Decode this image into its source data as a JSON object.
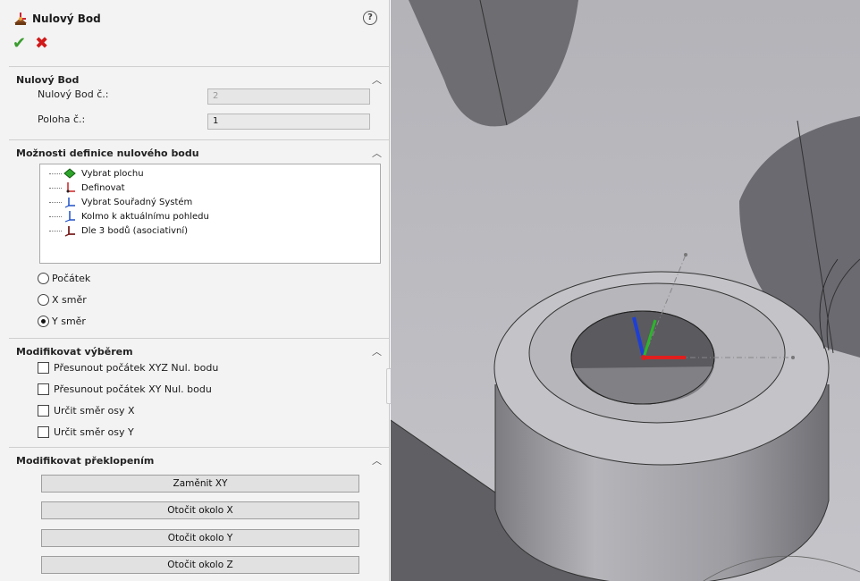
{
  "header": {
    "title": "Nulový Bod",
    "help_icon": "question-circle-icon",
    "ok_icon": "checkmark-icon",
    "cancel_icon": "close-x-icon"
  },
  "section_nulovy_bod": {
    "title": "Nulový Bod",
    "fields": [
      {
        "label": "Nulový Bod č.:",
        "value": "2",
        "disabled": true
      },
      {
        "label": "Poloha č.:",
        "value": "1",
        "disabled": false
      }
    ]
  },
  "section_moznosti": {
    "title": "Možnosti definice nulového bodu",
    "tree_items": [
      {
        "label": "Vybrat plochu",
        "icon": "face-select-icon"
      },
      {
        "label": "Definovat",
        "icon": "define-axes-icon"
      },
      {
        "label": "Vybrat Souřadný Systém",
        "icon": "coordinate-system-icon"
      },
      {
        "label": "Kolmo k aktuálnímu pohledu",
        "icon": "normal-to-view-icon"
      },
      {
        "label": "Dle 3 bodů (asociativní)",
        "icon": "three-points-icon"
      }
    ],
    "radios": [
      {
        "label": "Počátek",
        "checked": false
      },
      {
        "label": "X směr",
        "checked": false
      },
      {
        "label": "Y směr",
        "checked": true
      }
    ]
  },
  "section_vyberem": {
    "title": "Modifikovat výběrem",
    "checkboxes": [
      {
        "label": "Přesunout počátek XYZ Nul. bodu",
        "checked": false
      },
      {
        "label": "Přesunout počátek XY Nul. bodu",
        "checked": false
      },
      {
        "label": "Určit směr osy X",
        "checked": false
      },
      {
        "label": "Určit směr osy Y",
        "checked": false
      }
    ]
  },
  "section_preklopenim": {
    "title": "Modifikovat překlopením",
    "buttons": [
      {
        "label": "Zaměnit XY"
      },
      {
        "label": "Otočit okolo X"
      },
      {
        "label": "Otočit okolo Y"
      },
      {
        "label": "Otočit okolo Z"
      }
    ]
  },
  "viewport": {
    "axis_x_color": "#e01e1e",
    "axis_y_color": "#2bb52b",
    "axis_z_color": "#1e3fd6",
    "model_color": "#a9a9ad"
  }
}
